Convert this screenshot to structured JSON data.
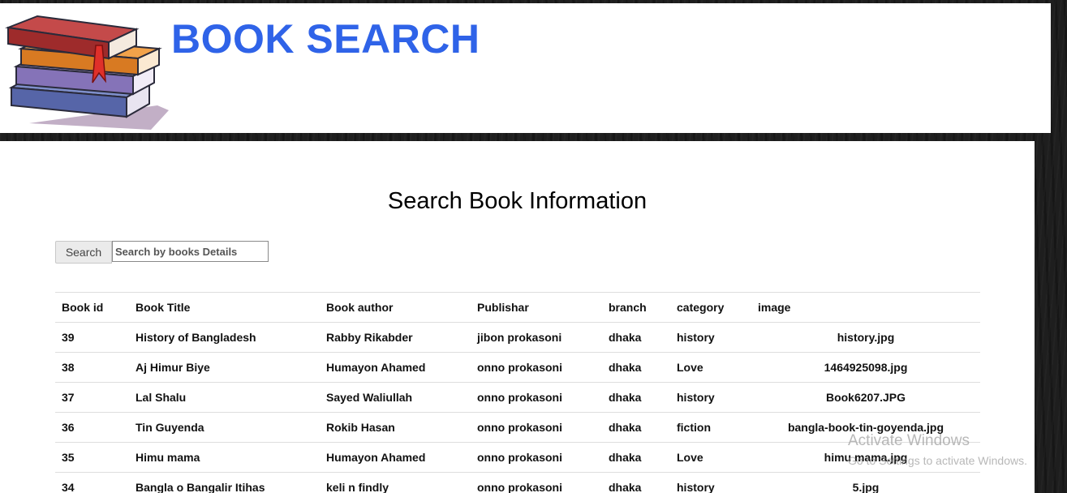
{
  "header": {
    "title": "BOOK SEARCH",
    "logo_icon": "books-stack-icon"
  },
  "main": {
    "heading": "Search Book Information",
    "search": {
      "button_label": "Search",
      "placeholder": "Search by books Details"
    },
    "table": {
      "headers": [
        "Book id",
        "Book Title",
        "Book author",
        "Publishar",
        "branch",
        "category",
        "image"
      ],
      "rows": [
        [
          "39",
          "History of Bangladesh",
          "Rabby Rikabder",
          "jibon prokasoni",
          "dhaka",
          "history",
          "history.jpg"
        ],
        [
          "38",
          "Aj Himur Biye",
          "Humayon Ahamed",
          "onno prokasoni",
          "dhaka",
          "Love",
          "1464925098.jpg"
        ],
        [
          "37",
          "Lal Shalu",
          "Sayed Waliullah",
          "onno prokasoni",
          "dhaka",
          "history",
          "Book6207.JPG"
        ],
        [
          "36",
          "Tin Guyenda",
          "Rokib Hasan",
          "onno prokasoni",
          "dhaka",
          "fiction",
          "bangla-book-tin-goyenda.jpg"
        ],
        [
          "35",
          "Himu mama",
          "Humayon Ahamed",
          "onno prokasoni",
          "dhaka",
          "Love",
          "himu mama.jpg"
        ],
        [
          "34",
          "Bangla o Bangalir Itihas",
          "keli n findly",
          "onno prokasoni",
          "dhaka",
          "history",
          "5.jpg"
        ]
      ]
    }
  },
  "watermark": {
    "title": "Activate Windows",
    "subtitle": "Go to Settings to activate Windows."
  },
  "colors": {
    "title_blue": "#2f63e8",
    "background_dark": "#1e1e1e"
  }
}
